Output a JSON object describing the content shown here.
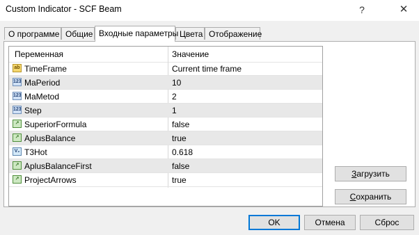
{
  "window": {
    "title": "Custom Indicator - SCF Beam",
    "help_label": "?",
    "close_label": "✕"
  },
  "tabs": [
    {
      "label": "О программе"
    },
    {
      "label": "Общие"
    },
    {
      "label": "Входные параметры",
      "active": true
    },
    {
      "label": "Цвета"
    },
    {
      "label": "Отображение"
    }
  ],
  "grid": {
    "col_variable": "Переменная",
    "col_value": "Значение",
    "rows": [
      {
        "type": "string",
        "type_badge": "ab",
        "name": "TimeFrame",
        "value": "Current time frame"
      },
      {
        "type": "int",
        "type_badge": "123",
        "name": "MaPeriod",
        "value": "10"
      },
      {
        "type": "int",
        "type_badge": "123",
        "name": "MaMetod",
        "value": "2"
      },
      {
        "type": "int",
        "type_badge": "123",
        "name": "Step",
        "value": "1"
      },
      {
        "type": "bool",
        "type_badge": "↗",
        "name": "SuperiorFormula",
        "value": "false"
      },
      {
        "type": "bool",
        "type_badge": "↗",
        "name": "AplusBalance",
        "value": "true"
      },
      {
        "type": "double",
        "type_badge": "V₂",
        "name": "T3Hot",
        "value": "0.618"
      },
      {
        "type": "bool",
        "type_badge": "↗",
        "name": "AplusBalanceFirst",
        "value": "false"
      },
      {
        "type": "bool",
        "type_badge": "↗",
        "name": "ProjectArrows",
        "value": "true"
      }
    ]
  },
  "buttons": {
    "load_mnemonic": "З",
    "load_rest": "агрузить",
    "save_mnemonic": "С",
    "save_rest": "охранить",
    "ok": "OK",
    "cancel": "Отмена",
    "reset": "Сброс"
  }
}
